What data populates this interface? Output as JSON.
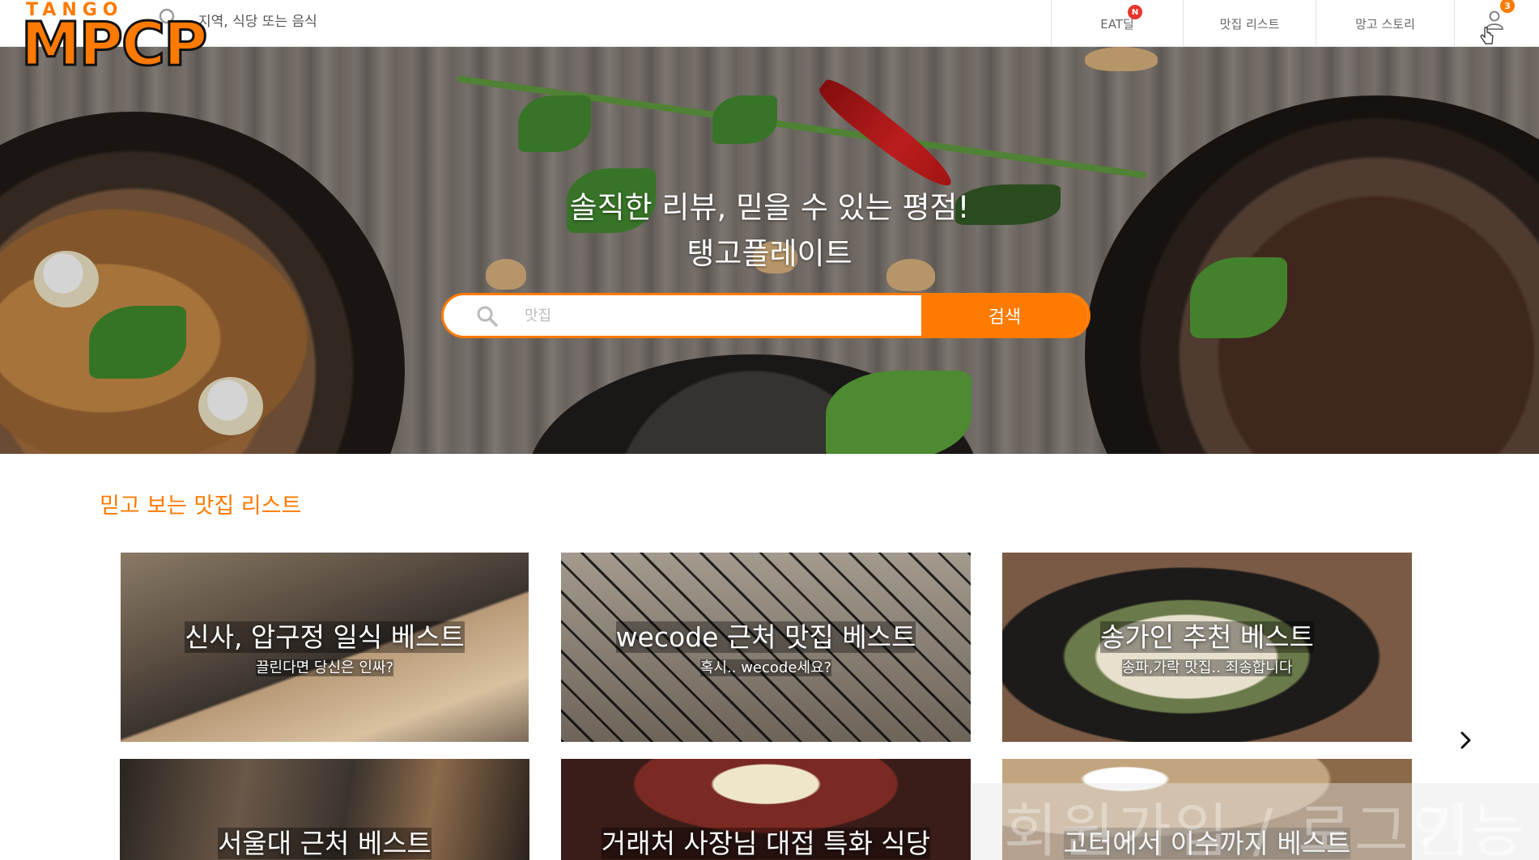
{
  "brand": {
    "logo_top": "TANGO",
    "logo_main": "MPCP"
  },
  "header": {
    "search_text": "지역, 식당 또는 음식",
    "nav": [
      {
        "label": "EAT딜",
        "badge": "N"
      },
      {
        "label": "맛집 리스트"
      },
      {
        "label": "망고 스토리"
      }
    ],
    "user_badge": "3"
  },
  "hero": {
    "title_line1": "솔직한 리뷰, 믿을 수 있는 평점!",
    "title_line2": "탱고플레이트",
    "search_placeholder": "맛집",
    "search_button": "검색"
  },
  "section": {
    "title": "믿고 보는 맛집 리스트",
    "cards": [
      {
        "title": "신사, 압구정 일식 베스트",
        "subtitle": "끌린다면 당신은 인싸?"
      },
      {
        "title": "wecode 근처 맛집 베스트",
        "subtitle": "혹시.. wecode세요?"
      },
      {
        "title": "송가인 추천 베스트",
        "subtitle": "송파,가락 맛집.. 죄송합니다"
      },
      {
        "title": "서울대 근처 베스트",
        "subtitle": ""
      },
      {
        "title": "거래처 사장님 대접 특화 식당",
        "subtitle": ""
      },
      {
        "title": "고터에서 이수까지 베스트",
        "subtitle": ""
      }
    ]
  },
  "watermark": {
    "text": "회원가입 / 로그인",
    "tail": "기능"
  },
  "colors": {
    "accent": "#ff7a00",
    "badge_red": "#e8352b"
  },
  "icons": [
    "search-icon",
    "user-icon",
    "cursor-icon",
    "chevron-right-icon"
  ]
}
